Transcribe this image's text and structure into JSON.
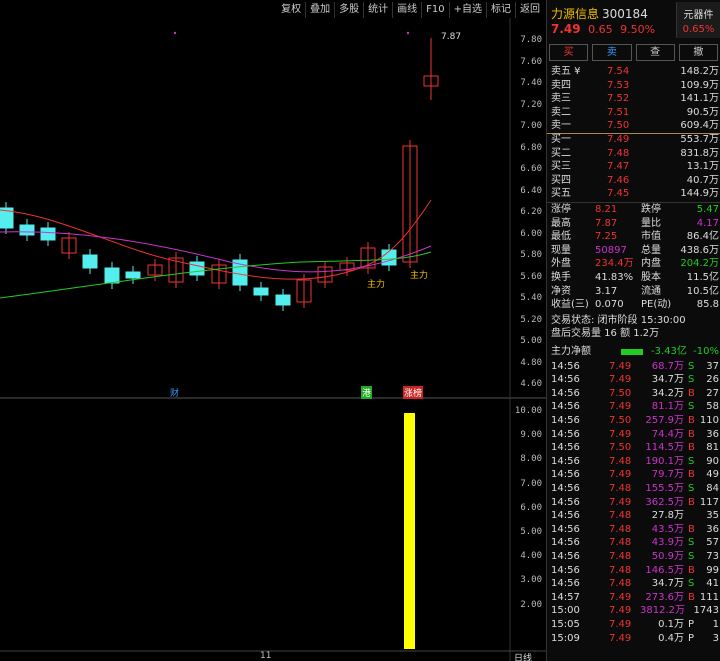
{
  "toolbar": [
    "复权",
    "叠加",
    "多股",
    "统计",
    "画线",
    "F10",
    "+自选",
    "标记",
    "返回"
  ],
  "axis_top": [
    "7.80",
    "7.60",
    "7.40",
    "7.20",
    "7.00",
    "6.80",
    "6.60",
    "6.40",
    "6.20",
    "6.00",
    "5.80",
    "5.60",
    "5.40",
    "5.20",
    "5.00",
    "4.80",
    "4.60"
  ],
  "axis_bottom": [
    "10.00",
    "9.00",
    "8.00",
    "7.00",
    "6.00",
    "5.00",
    "4.00",
    "3.00",
    "2.00"
  ],
  "chart_labels": {
    "high": "7.87",
    "zhuli1": "主力",
    "zhuli2": "主力",
    "cai": "财",
    "gang": "港",
    "zhangting": "涨榜",
    "date": "11",
    "tab": "日线"
  },
  "stock": {
    "name": "力源信息",
    "code": "300184",
    "tag": "元器件",
    "tag_pct": "0.65%",
    "price": "7.49",
    "chg": "0.65",
    "pct": "9.50%"
  },
  "trade_buttons": [
    "买",
    "卖",
    "查",
    "撤"
  ],
  "asks": [
    {
      "label": "卖五 ¥",
      "price": "7.54",
      "vol": "148.2万"
    },
    {
      "label": "卖四",
      "price": "7.53",
      "vol": "109.9万"
    },
    {
      "label": "卖三",
      "price": "7.52",
      "vol": "141.1万"
    },
    {
      "label": "卖二",
      "price": "7.51",
      "vol": "90.5万"
    },
    {
      "label": "卖一",
      "price": "7.50",
      "vol": "609.4万"
    }
  ],
  "bids": [
    {
      "label": "买一",
      "price": "7.49",
      "vol": "553.7万"
    },
    {
      "label": "买二",
      "price": "7.48",
      "vol": "831.8万"
    },
    {
      "label": "买三",
      "price": "7.47",
      "vol": "13.1万"
    },
    {
      "label": "买四",
      "price": "7.46",
      "vol": "40.7万"
    },
    {
      "label": "买五",
      "price": "7.45",
      "vol": "144.9万"
    }
  ],
  "stats": [
    {
      "k1": "涨停",
      "v1": "8.21",
      "c1": "red",
      "k2": "跌停",
      "v2": "5.47",
      "c2": "green"
    },
    {
      "k1": "最高",
      "v1": "7.87",
      "c1": "red",
      "k2": "量比",
      "v2": "4.17",
      "c2": "mag"
    },
    {
      "k1": "最低",
      "v1": "7.25",
      "c1": "red",
      "k2": "市值",
      "v2": "86.4亿",
      "c2": "wht"
    },
    {
      "k1": "现量",
      "v1": "50897",
      "c1": "mag",
      "k2": "总量",
      "v2": "438.6万",
      "c2": "wht"
    },
    {
      "k1": "外盘",
      "v1": "234.4万",
      "c1": "red",
      "k2": "内盘",
      "v2": "204.2万",
      "c2": "green"
    },
    {
      "k1": "换手",
      "v1": "41.83%",
      "c1": "wht",
      "k2": "股本",
      "v2": "11.5亿",
      "c2": "wht"
    },
    {
      "k1": "净资",
      "v1": "3.17",
      "c1": "wht",
      "k2": "流通",
      "v2": "10.5亿",
      "c2": "wht"
    },
    {
      "k1": "收益(三)",
      "v1": "0.070",
      "c1": "wht",
      "k2": "PE(动)",
      "v2": "85.8",
      "c2": "wht"
    }
  ],
  "status1": "交易状态: 闭市阶段 15:30:00",
  "status2": "盘后交易量 16 额 1.2万",
  "flow": {
    "label": "主力净额",
    "value": "-3.43亿",
    "pct": "-10%"
  },
  "ticks": [
    {
      "t": "14:56",
      "p": "7.49",
      "v": "68.7万",
      "s": "S",
      "n": "37",
      "pc": "red",
      "vc": "mag"
    },
    {
      "t": "14:56",
      "p": "7.49",
      "v": "34.7万",
      "s": "S",
      "n": "26",
      "pc": "red",
      "vc": "wht"
    },
    {
      "t": "14:56",
      "p": "7.50",
      "v": "34.2万",
      "s": "B",
      "n": "27",
      "pc": "red",
      "vc": "wht"
    },
    {
      "t": "14:56",
      "p": "7.49",
      "v": "81.1万",
      "s": "S",
      "n": "58",
      "pc": "red",
      "vc": "mag"
    },
    {
      "t": "14:56",
      "p": "7.50",
      "v": "257.9万",
      "s": "B",
      "n": "110",
      "pc": "red",
      "vc": "mag"
    },
    {
      "t": "14:56",
      "p": "7.49",
      "v": "74.4万",
      "s": "B",
      "n": "36",
      "pc": "red",
      "vc": "mag"
    },
    {
      "t": "14:56",
      "p": "7.50",
      "v": "114.5万",
      "s": "B",
      "n": "81",
      "pc": "red",
      "vc": "mag"
    },
    {
      "t": "14:56",
      "p": "7.48",
      "v": "190.1万",
      "s": "S",
      "n": "90",
      "pc": "red",
      "vc": "mag"
    },
    {
      "t": "14:56",
      "p": "7.49",
      "v": "79.7万",
      "s": "B",
      "n": "49",
      "pc": "red",
      "vc": "mag"
    },
    {
      "t": "14:56",
      "p": "7.48",
      "v": "155.5万",
      "s": "S",
      "n": "84",
      "pc": "red",
      "vc": "mag"
    },
    {
      "t": "14:56",
      "p": "7.49",
      "v": "362.5万",
      "s": "B",
      "n": "117",
      "pc": "red",
      "vc": "mag"
    },
    {
      "t": "14:56",
      "p": "7.48",
      "v": "27.8万",
      "s": "",
      "n": "35",
      "pc": "red",
      "vc": "wht"
    },
    {
      "t": "14:56",
      "p": "7.48",
      "v": "43.5万",
      "s": "B",
      "n": "36",
      "pc": "red",
      "vc": "mag"
    },
    {
      "t": "14:56",
      "p": "7.48",
      "v": "43.9万",
      "s": "S",
      "n": "57",
      "pc": "red",
      "vc": "mag"
    },
    {
      "t": "14:56",
      "p": "7.48",
      "v": "50.9万",
      "s": "S",
      "n": "73",
      "pc": "red",
      "vc": "mag"
    },
    {
      "t": "14:56",
      "p": "7.48",
      "v": "146.5万",
      "s": "B",
      "n": "99",
      "pc": "red",
      "vc": "mag"
    },
    {
      "t": "14:56",
      "p": "7.48",
      "v": "34.7万",
      "s": "S",
      "n": "41",
      "pc": "red",
      "vc": "wht"
    },
    {
      "t": "14:57",
      "p": "7.49",
      "v": "273.6万",
      "s": "B",
      "n": "111",
      "pc": "red",
      "vc": "mag"
    },
    {
      "t": "15:00",
      "p": "7.49",
      "v": "3812.2万",
      "s": "",
      "n": "1743",
      "pc": "red",
      "vc": "mag"
    },
    {
      "t": "15:05",
      "p": "7.49",
      "v": "0.1万",
      "s": "P",
      "n": "1",
      "pc": "red",
      "vc": "wht"
    },
    {
      "t": "15:09",
      "p": "7.49",
      "v": "0.4万",
      "s": "P",
      "n": "3",
      "pc": "red",
      "vc": "wht"
    }
  ]
}
